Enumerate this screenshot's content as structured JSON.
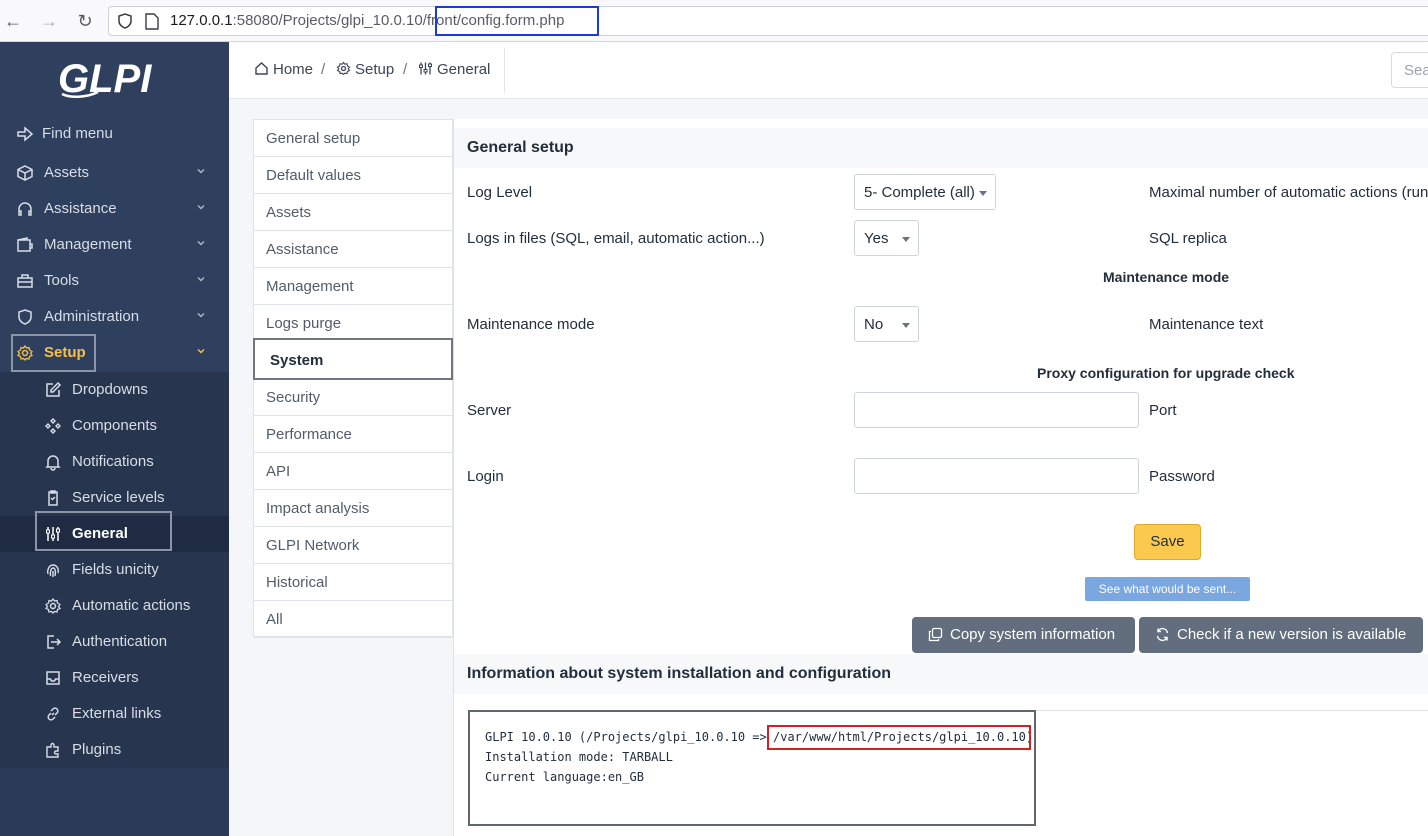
{
  "browser": {
    "url_host": "127.0.0.1",
    "url_rest": ":58080/Projects/glpi_10.0.10/front/config.form.php"
  },
  "sidebar": {
    "logo": "GLPI",
    "find_menu": "Find menu",
    "items": [
      {
        "label": "Assets",
        "icon": "cube-icon"
      },
      {
        "label": "Assistance",
        "icon": "headset-icon"
      },
      {
        "label": "Management",
        "icon": "wallet-icon"
      },
      {
        "label": "Tools",
        "icon": "briefcase-icon"
      },
      {
        "label": "Administration",
        "icon": "shield-icon"
      },
      {
        "label": "Setup",
        "icon": "gear-icon"
      }
    ],
    "submenu": [
      {
        "label": "Dropdowns",
        "icon": "edit-icon"
      },
      {
        "label": "Components",
        "icon": "components-icon"
      },
      {
        "label": "Notifications",
        "icon": "bell-icon"
      },
      {
        "label": "Service levels",
        "icon": "clipboard-icon"
      },
      {
        "label": "General",
        "icon": "sliders-icon"
      },
      {
        "label": "Fields unicity",
        "icon": "fingerprint-icon"
      },
      {
        "label": "Automatic actions",
        "icon": "settings-icon"
      },
      {
        "label": "Authentication",
        "icon": "login-icon"
      },
      {
        "label": "Receivers",
        "icon": "inbox-icon"
      },
      {
        "label": "External links",
        "icon": "link-icon"
      },
      {
        "label": "Plugins",
        "icon": "puzzle-icon"
      }
    ]
  },
  "header": {
    "breadcrumb": [
      "Home",
      "Setup",
      "General"
    ],
    "search_placeholder": "Sea"
  },
  "tabs": [
    "General setup",
    "Default values",
    "Assets",
    "Assistance",
    "Management",
    "Logs purge",
    "System",
    "Security",
    "Performance",
    "API",
    "Impact analysis",
    "GLPI Network",
    "Historical",
    "All"
  ],
  "active_tab": "System",
  "form": {
    "section_title": "General setup",
    "log_level_label": "Log Level",
    "log_level_value": "5- Complete (all)",
    "max_actions_label": "Maximal number of automatic actions (run",
    "logs_in_files_label": "Logs in files (SQL, email, automatic action...)",
    "logs_in_files_value": "Yes",
    "sql_replica_label": "SQL replica",
    "maintenance_title": "Maintenance mode",
    "maintenance_mode_label": "Maintenance mode",
    "maintenance_mode_value": "No",
    "maintenance_text_label": "Maintenance text",
    "proxy_title": "Proxy configuration for upgrade check",
    "server_label": "Server",
    "port_label": "Port",
    "login_label": "Login",
    "password_label": "Password",
    "save_label": "Save",
    "see_what_label": "See what would be sent...",
    "copy_label": "Copy system information",
    "check_label": "Check if a new version is available"
  },
  "info": {
    "title": "Information about system installation and configuration",
    "line1_prefix": "GLPI 10.0.10 (/Projects/glpi_10.0.10 =>",
    "line1_path": "/var/www/html/Projects/glpi_10.0.10)",
    "line2": "Installation mode: TARBALL",
    "line3": "Current language:en_GB"
  }
}
